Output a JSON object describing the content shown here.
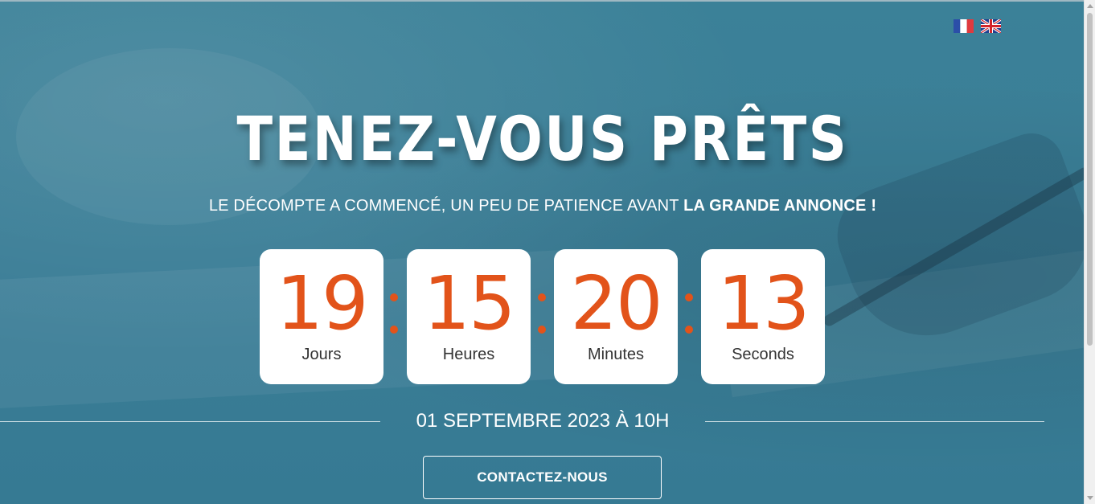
{
  "page": {
    "title": "TENEZ-VOUS PRÊTS",
    "subtitle_regular": "LE DÉCOMPTE A COMMENCÉ, UN PEU DE PATIENCE AVANT ",
    "subtitle_bold": "LA GRANDE ANNONCE !",
    "event_date": "01 SEPTEMBRE 2023 À 10H",
    "cta_label": "CONTACTEZ-NOUS"
  },
  "languages": [
    {
      "code": "fr",
      "icon": "french-flag-icon"
    },
    {
      "code": "en",
      "icon": "uk-flag-icon"
    }
  ],
  "countdown": [
    {
      "value": "19",
      "label": "Jours"
    },
    {
      "value": "15",
      "label": "Heures"
    },
    {
      "value": "20",
      "label": "Minutes"
    },
    {
      "value": "13",
      "label": "Seconds"
    }
  ],
  "colors": {
    "background": "#3a7f98",
    "accent": "#e2531a",
    "card": "#ffffff",
    "text_light": "#ffffff",
    "label_text": "#333333"
  }
}
